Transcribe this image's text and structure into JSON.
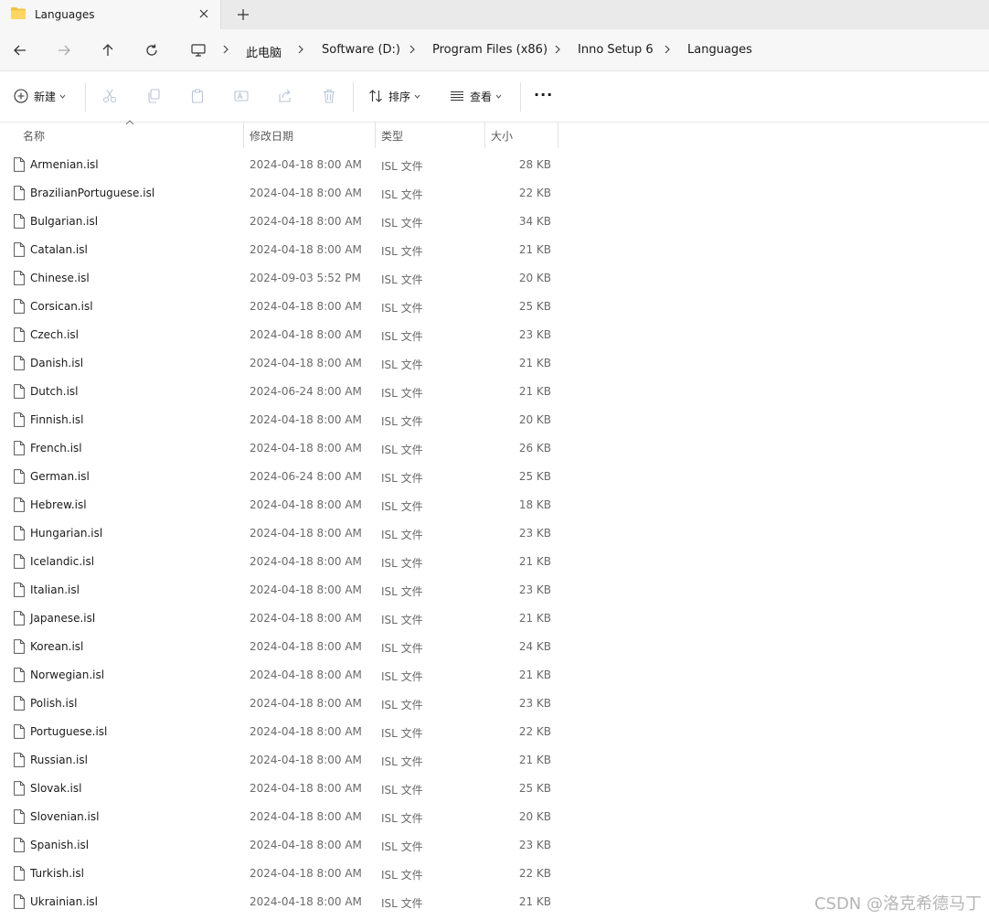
{
  "tab": {
    "title": "Languages",
    "icon": "folder-icon"
  },
  "breadcrumb": [
    "此电脑",
    "Software (D:)",
    "Program Files (x86)",
    "Inno Setup 6",
    "Languages"
  ],
  "toolbar": {
    "new_label": "新建",
    "sort_label": "排序",
    "view_label": "查看",
    "more_label": "···"
  },
  "columns": {
    "name": "名称",
    "date": "修改日期",
    "type": "类型",
    "size": "大小"
  },
  "files": [
    {
      "name": "Armenian.isl",
      "date": "2024-04-18 8:00 AM",
      "type": "ISL 文件",
      "size": "28 KB"
    },
    {
      "name": "BrazilianPortuguese.isl",
      "date": "2024-04-18 8:00 AM",
      "type": "ISL 文件",
      "size": "22 KB"
    },
    {
      "name": "Bulgarian.isl",
      "date": "2024-04-18 8:00 AM",
      "type": "ISL 文件",
      "size": "34 KB"
    },
    {
      "name": "Catalan.isl",
      "date": "2024-04-18 8:00 AM",
      "type": "ISL 文件",
      "size": "21 KB"
    },
    {
      "name": "Chinese.isl",
      "date": "2024-09-03 5:52 PM",
      "type": "ISL 文件",
      "size": "20 KB"
    },
    {
      "name": "Corsican.isl",
      "date": "2024-04-18 8:00 AM",
      "type": "ISL 文件",
      "size": "25 KB"
    },
    {
      "name": "Czech.isl",
      "date": "2024-04-18 8:00 AM",
      "type": "ISL 文件",
      "size": "23 KB"
    },
    {
      "name": "Danish.isl",
      "date": "2024-04-18 8:00 AM",
      "type": "ISL 文件",
      "size": "21 KB"
    },
    {
      "name": "Dutch.isl",
      "date": "2024-06-24 8:00 AM",
      "type": "ISL 文件",
      "size": "21 KB"
    },
    {
      "name": "Finnish.isl",
      "date": "2024-04-18 8:00 AM",
      "type": "ISL 文件",
      "size": "20 KB"
    },
    {
      "name": "French.isl",
      "date": "2024-04-18 8:00 AM",
      "type": "ISL 文件",
      "size": "26 KB"
    },
    {
      "name": "German.isl",
      "date": "2024-06-24 8:00 AM",
      "type": "ISL 文件",
      "size": "25 KB"
    },
    {
      "name": "Hebrew.isl",
      "date": "2024-04-18 8:00 AM",
      "type": "ISL 文件",
      "size": "18 KB"
    },
    {
      "name": "Hungarian.isl",
      "date": "2024-04-18 8:00 AM",
      "type": "ISL 文件",
      "size": "23 KB"
    },
    {
      "name": "Icelandic.isl",
      "date": "2024-04-18 8:00 AM",
      "type": "ISL 文件",
      "size": "21 KB"
    },
    {
      "name": "Italian.isl",
      "date": "2024-04-18 8:00 AM",
      "type": "ISL 文件",
      "size": "23 KB"
    },
    {
      "name": "Japanese.isl",
      "date": "2024-04-18 8:00 AM",
      "type": "ISL 文件",
      "size": "21 KB"
    },
    {
      "name": "Korean.isl",
      "date": "2024-04-18 8:00 AM",
      "type": "ISL 文件",
      "size": "24 KB"
    },
    {
      "name": "Norwegian.isl",
      "date": "2024-04-18 8:00 AM",
      "type": "ISL 文件",
      "size": "21 KB"
    },
    {
      "name": "Polish.isl",
      "date": "2024-04-18 8:00 AM",
      "type": "ISL 文件",
      "size": "23 KB"
    },
    {
      "name": "Portuguese.isl",
      "date": "2024-04-18 8:00 AM",
      "type": "ISL 文件",
      "size": "22 KB"
    },
    {
      "name": "Russian.isl",
      "date": "2024-04-18 8:00 AM",
      "type": "ISL 文件",
      "size": "21 KB"
    },
    {
      "name": "Slovak.isl",
      "date": "2024-04-18 8:00 AM",
      "type": "ISL 文件",
      "size": "25 KB"
    },
    {
      "name": "Slovenian.isl",
      "date": "2024-04-18 8:00 AM",
      "type": "ISL 文件",
      "size": "20 KB"
    },
    {
      "name": "Spanish.isl",
      "date": "2024-04-18 8:00 AM",
      "type": "ISL 文件",
      "size": "23 KB"
    },
    {
      "name": "Turkish.isl",
      "date": "2024-04-18 8:00 AM",
      "type": "ISL 文件",
      "size": "22 KB"
    },
    {
      "name": "Ukrainian.isl",
      "date": "2024-04-18 8:00 AM",
      "type": "ISL 文件",
      "size": "21 KB"
    }
  ],
  "watermark": "CSDN @洛克希德马丁",
  "colors": {
    "folder": "#f5c242",
    "icon_gray": "#555555",
    "disabled_icon": "#b8c4d6"
  }
}
